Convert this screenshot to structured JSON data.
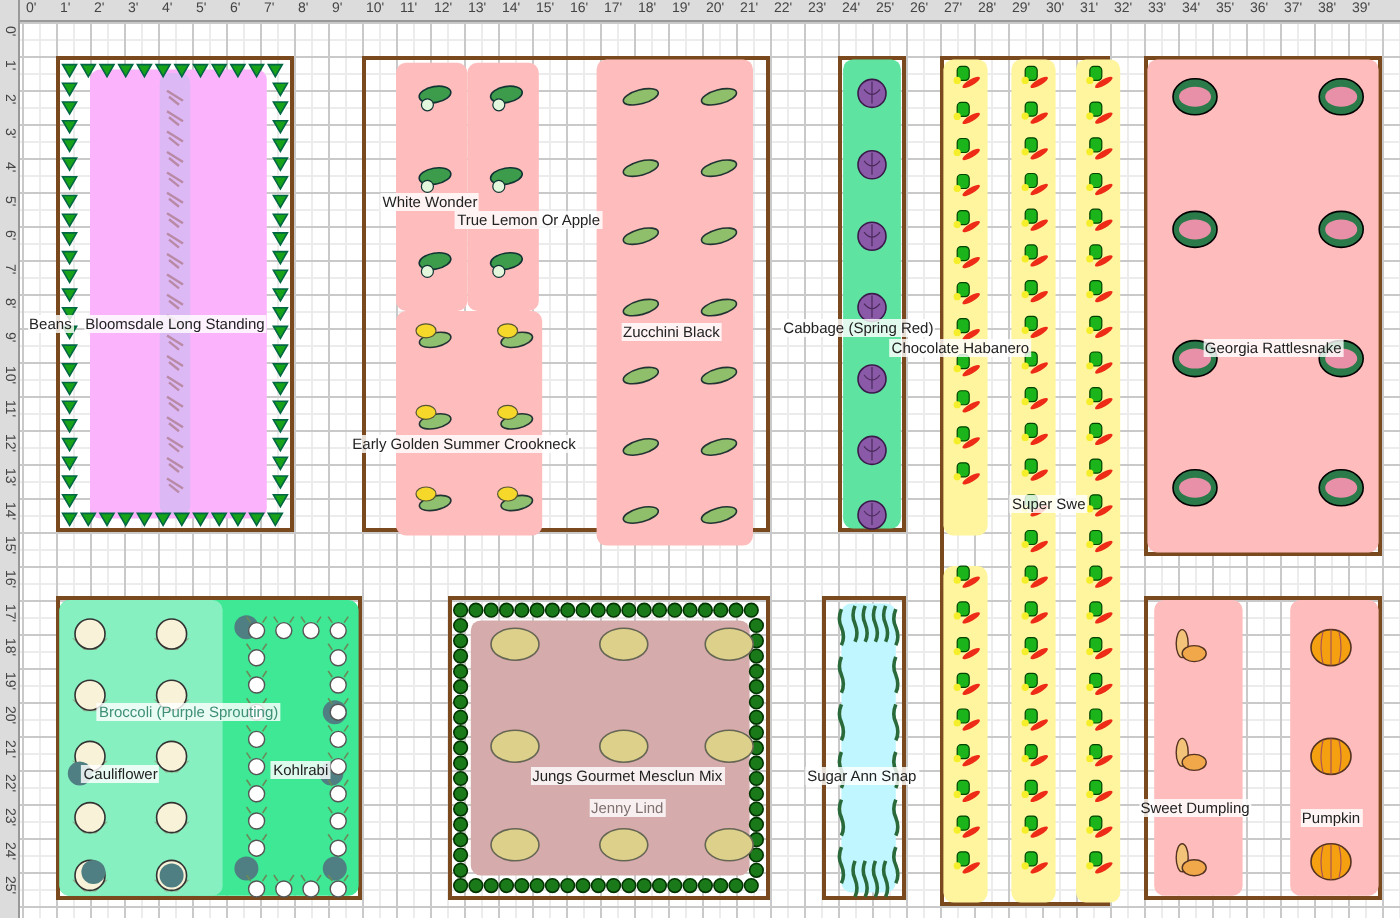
{
  "rulers": {
    "top": [
      "0'",
      "1'",
      "2'",
      "3'",
      "4'",
      "5'",
      "6'",
      "7'",
      "8'",
      "9'",
      "10'",
      "11'",
      "12'",
      "13'",
      "14'",
      "15'",
      "16'",
      "17'",
      "18'",
      "19'",
      "20'",
      "21'",
      "22'",
      "23'",
      "24'",
      "25'",
      "26'",
      "27'",
      "28'",
      "29'",
      "30'",
      "31'",
      "32'",
      "33'",
      "34'",
      "35'",
      "36'",
      "37'",
      "38'",
      "39'"
    ],
    "left": [
      "0'",
      "1'",
      "2'",
      "3'",
      "4'",
      "5'",
      "6'",
      "7'",
      "8'",
      "9'",
      "10'",
      "11'",
      "12'",
      "13'",
      "14'",
      "15'",
      "16'",
      "17'",
      "18'",
      "19'",
      "20'",
      "21'",
      "22'",
      "23'",
      "24'",
      "25'"
    ]
  },
  "beds": [
    {
      "plantings": [
        {
          "kind": "bean",
          "label": "Beans"
        },
        {
          "kind": "spinach",
          "label": "Bloomsdale Long Standing"
        },
        {
          "kind": "vine"
        }
      ]
    },
    {
      "plantings": [
        {
          "kind": "cucumber",
          "label": "White Wonder"
        },
        {
          "kind": "cucumber",
          "label": "True Lemon Or Apple"
        },
        {
          "kind": "crookneck",
          "label": "Early Golden Summer Crookneck"
        },
        {
          "kind": "zucchini",
          "label": "Zucchini Black"
        }
      ]
    },
    {
      "plantings": [
        {
          "kind": "cabbage",
          "label": "Cabbage (Spring Red)"
        }
      ]
    },
    {
      "plantings": [
        {
          "kind": "pepper",
          "label": "Chocolate Habanero"
        },
        {
          "kind": "pepper",
          "label": "Super Swe"
        }
      ]
    },
    {
      "plantings": [
        {
          "kind": "watermelon",
          "label": "Georgia Rattlesnake"
        }
      ]
    },
    {
      "plantings": [
        {
          "kind": "cauliflower",
          "label": "Cauliflower"
        },
        {
          "kind": "broccoli",
          "label": "Broccoli (Purple Sprouting)"
        },
        {
          "kind": "kohlrabi",
          "label": "Kohlrabi"
        }
      ]
    },
    {
      "plantings": [
        {
          "kind": "lettuce",
          "label": "Jungs Gourmet Mesclun Mix"
        },
        {
          "kind": "melon",
          "label": "Jenny Lind"
        }
      ]
    },
    {
      "plantings": [
        {
          "kind": "pea",
          "label": "Sugar Ann Snap"
        }
      ]
    },
    {
      "plantings": [
        {
          "kind": "winter-squash",
          "label": "Sweet Dumpling"
        },
        {
          "kind": "pumpkin",
          "label": "Pumpkin"
        }
      ]
    }
  ]
}
